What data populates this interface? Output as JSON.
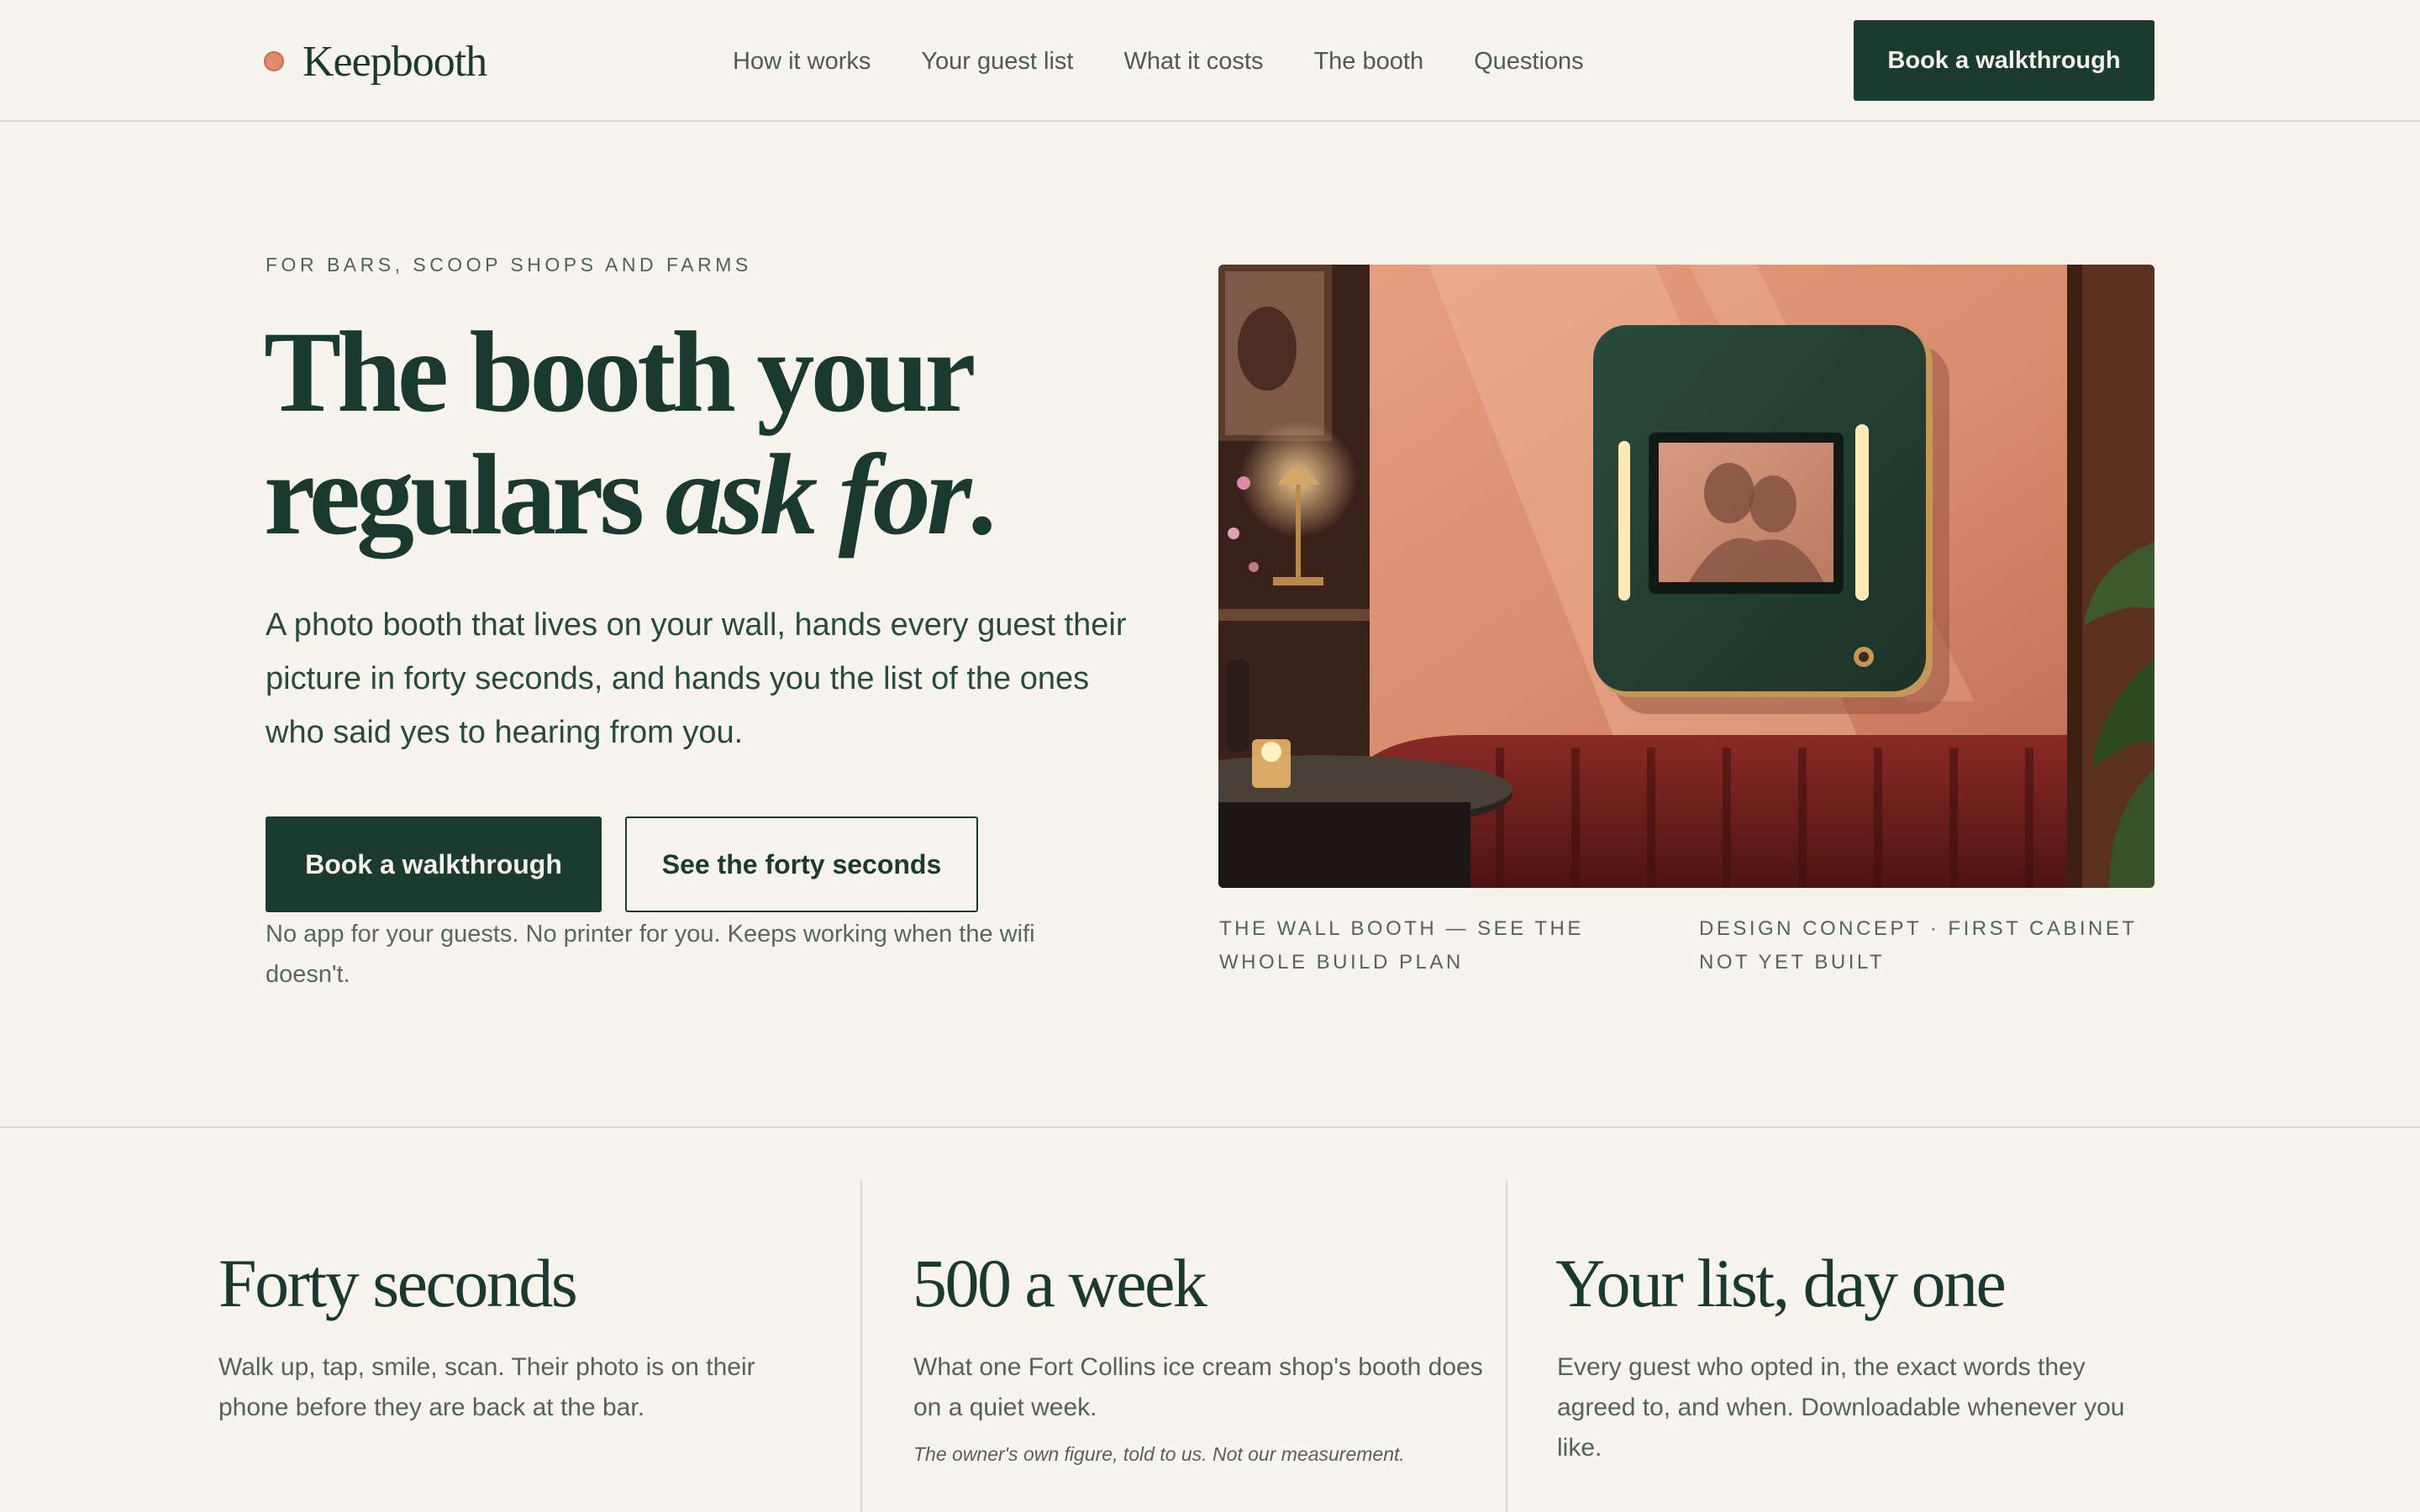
{
  "nav": {
    "brand": "Keepbooth",
    "links": [
      "How it works",
      "Your guest list",
      "What it costs",
      "The booth",
      "Questions"
    ],
    "cta": "Book a walkthrough"
  },
  "hero": {
    "eyebrow": "FOR BARS, SCOOP SHOPS AND FARMS",
    "headline_line1": "The booth your",
    "headline_line2_plain": "regulars ",
    "headline_line2_italic": "ask for",
    "headline_period": ".",
    "lede": "A photo booth that lives on your wall, hands every guest their picture in forty seconds, and hands you the list of the ones who said yes to hearing from you.",
    "primary_cta": "Book a walkthrough",
    "secondary_cta": "See the forty seconds",
    "note": "No app for your guests. No printer for you. Keeps working when the wifi doesn't.",
    "caption_left": "THE WALL BOOTH — SEE THE WHOLE BUILD PLAN",
    "caption_right": "DESIGN CONCEPT · FIRST CABINET NOT YET BUILT"
  },
  "stats": [
    {
      "title": "Forty seconds",
      "body": "Walk up, tap, smile, scan. Their photo is on their phone before they are back at the bar."
    },
    {
      "title": "500 a week",
      "body": "What one Fort Collins ice cream shop's booth does on a quiet week.",
      "footnote": "The owner's own figure, told to us. Not our measurement."
    },
    {
      "title": "Your list, day one",
      "body": "Every guest who opted in, the exact words they agreed to, and when. Downloadable whenever you like."
    }
  ],
  "colors": {
    "background": "#f7f4ee",
    "ink": "#1b3a2f",
    "accent_dot": "#e08a68",
    "button": "#1b3a30"
  }
}
